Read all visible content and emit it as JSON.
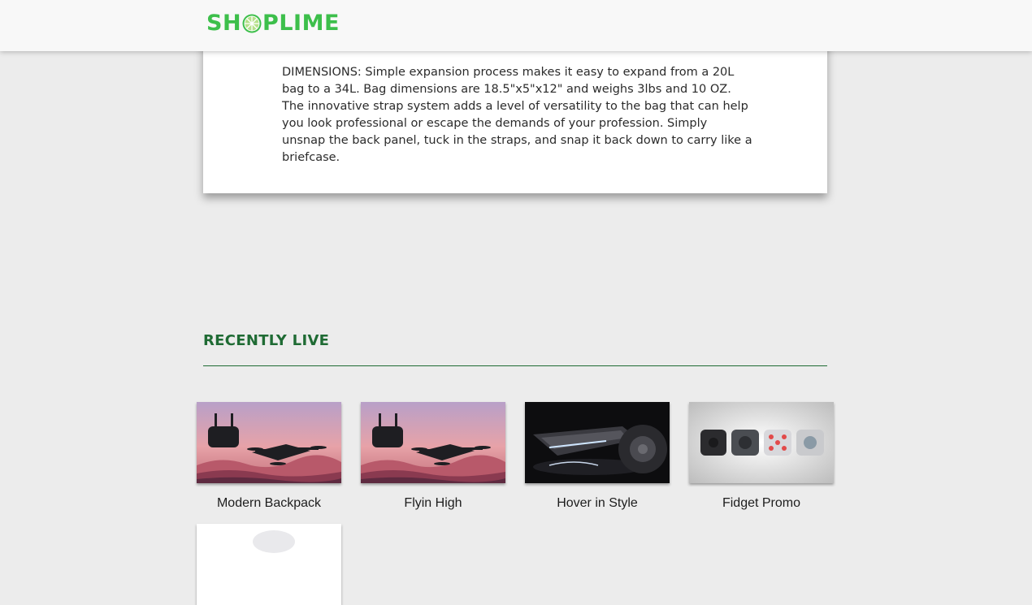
{
  "header": {
    "logo_text_before": "SH",
    "logo_icon": "lime-slice-icon",
    "logo_text_after": "PLIME",
    "brand_color": "#3dbf4b"
  },
  "description": {
    "text": "DIMENSIONS: Simple expansion process makes it easy to expand from a 20L bag to a 34L. Bag dimensions are 18.5\"x5\"x12\" and weighs 3lbs and 10 OZ. The innovative strap system adds a level of versatility to the bag that can help you look professional or escape the demands of your profession. Simply unsnap the back panel, tuck in the straps, and snap it back down to carry like a briefcase."
  },
  "recently_live": {
    "title": "RECENTLY LIVE",
    "accent_color": "#1f6b34",
    "items": [
      {
        "title": "Modern Backpack",
        "image": "drone-on-pink-mountains"
      },
      {
        "title": "Flyin High",
        "image": "drone-on-pink-mountains"
      },
      {
        "title": "Hover in Style",
        "image": "hoverboard-dark"
      },
      {
        "title": "Fidget Promo",
        "image": "fidget-cubes"
      },
      {
        "title": "",
        "image": "white-product"
      }
    ]
  }
}
